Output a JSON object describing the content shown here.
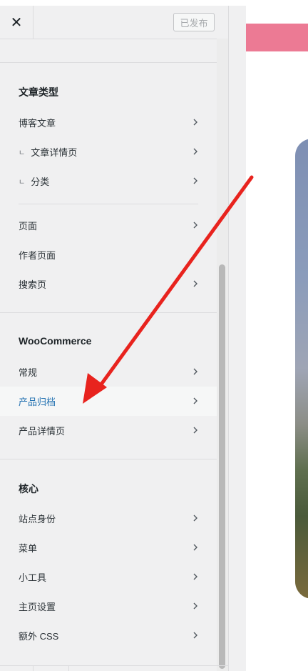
{
  "header": {
    "close_icon": "close-icon",
    "publish_label": "已发布",
    "peek_text": "..."
  },
  "sections": {
    "post_types": {
      "title": "文章类型",
      "items": [
        {
          "label": "博客文章",
          "chevron": true
        },
        {
          "label": "文章详情页",
          "chevron": true,
          "sub": true
        },
        {
          "label": "分类",
          "chevron": true,
          "sub": true
        },
        {
          "label": "页面",
          "chevron": true
        },
        {
          "label": "作者页面",
          "chevron": false
        },
        {
          "label": "搜索页",
          "chevron": true
        }
      ]
    },
    "woocommerce": {
      "title": "WooCommerce",
      "items": [
        {
          "label": "常规",
          "chevron": true
        },
        {
          "label": "产品归档",
          "chevron": true,
          "active": true
        },
        {
          "label": "产品详情页",
          "chevron": true
        }
      ]
    },
    "core": {
      "title": "核心",
      "items": [
        {
          "label": "站点身份",
          "chevron": true
        },
        {
          "label": "菜单",
          "chevron": true
        },
        {
          "label": "小工具",
          "chevron": true
        },
        {
          "label": "主页设置",
          "chevron": true
        },
        {
          "label": "额外 CSS",
          "chevron": true
        }
      ]
    }
  },
  "sub_marker": "ㄴ",
  "colors": {
    "active_text": "#2271b1",
    "preview_bar": "#ec7a94",
    "arrow": "#e8231e"
  }
}
